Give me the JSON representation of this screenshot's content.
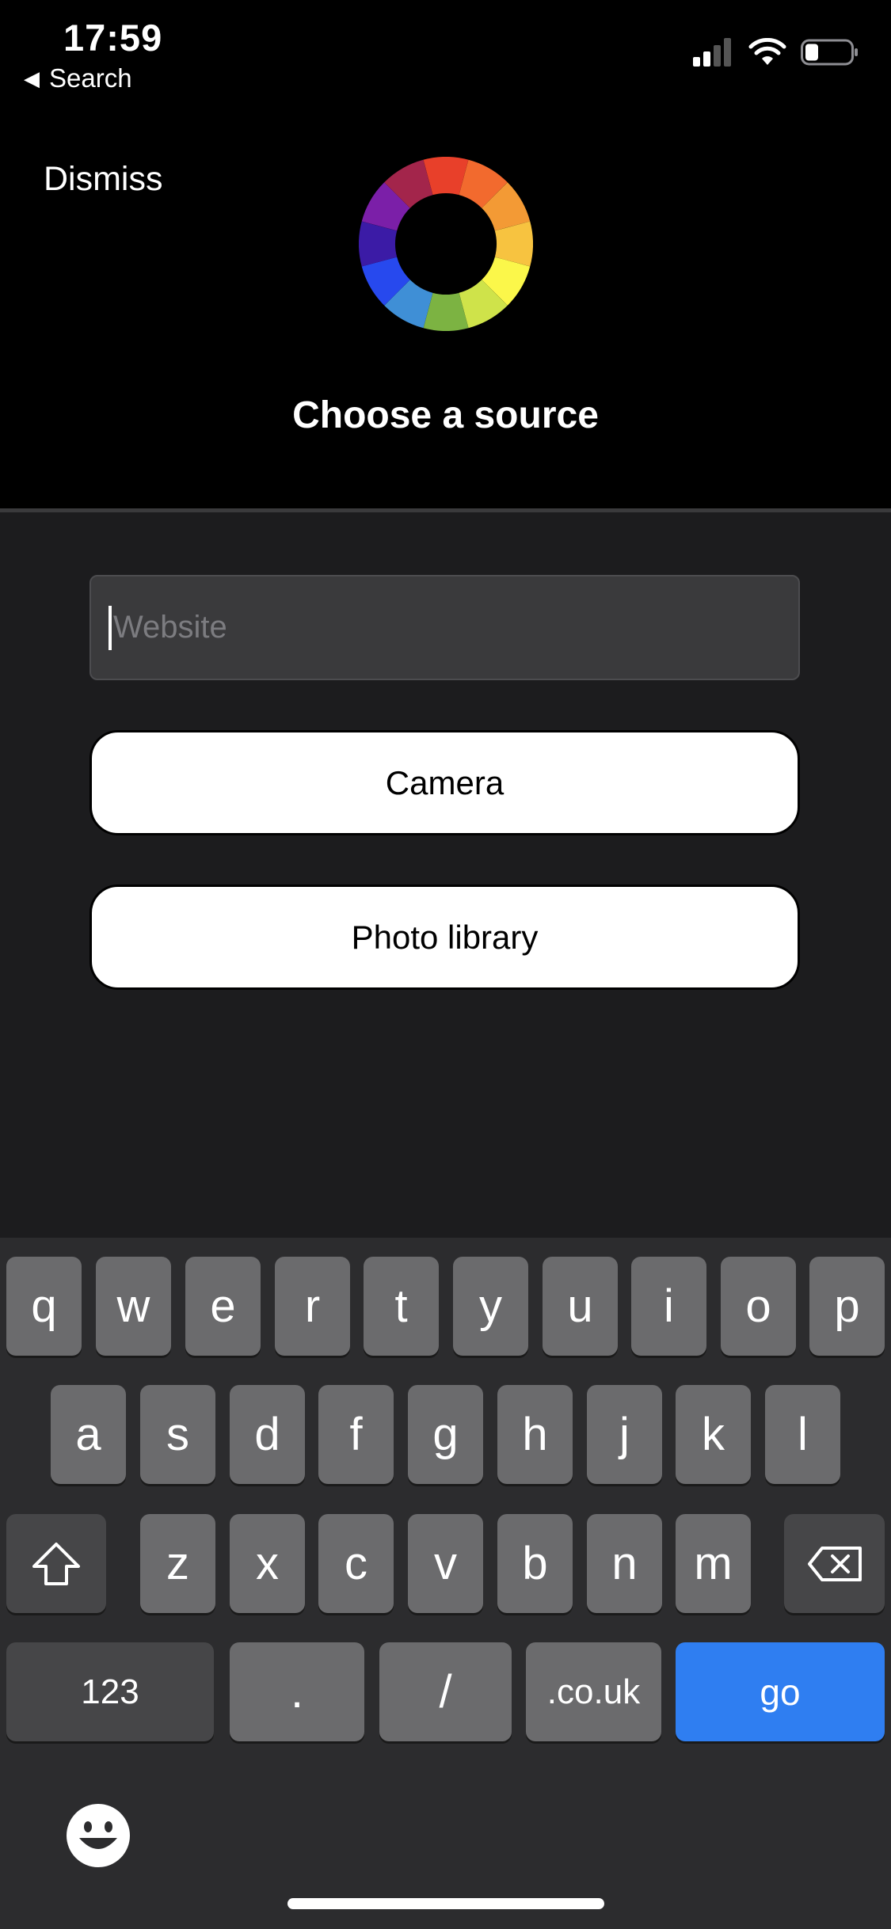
{
  "status_bar": {
    "time": "17:59",
    "back_app": "Search"
  },
  "header": {
    "dismiss_label": "Dismiss",
    "title": "Choose a source"
  },
  "form": {
    "website_placeholder": "Website",
    "camera_label": "Camera",
    "photo_library_label": "Photo library"
  },
  "keyboard": {
    "row1": [
      "q",
      "w",
      "e",
      "r",
      "t",
      "y",
      "u",
      "i",
      "o",
      "p"
    ],
    "row2": [
      "a",
      "s",
      "d",
      "f",
      "g",
      "h",
      "j",
      "k",
      "l"
    ],
    "row3": [
      "z",
      "x",
      "c",
      "v",
      "b",
      "n",
      "m"
    ],
    "numbers_label": "123",
    "dot_label": ".",
    "slash_label": "/",
    "domain_label": ".co.uk",
    "go_label": "go"
  },
  "colors": {
    "go_key": "#2f7ef1",
    "sheet_bg": "#1c1c1e",
    "key_bg": "#6b6b6d"
  }
}
